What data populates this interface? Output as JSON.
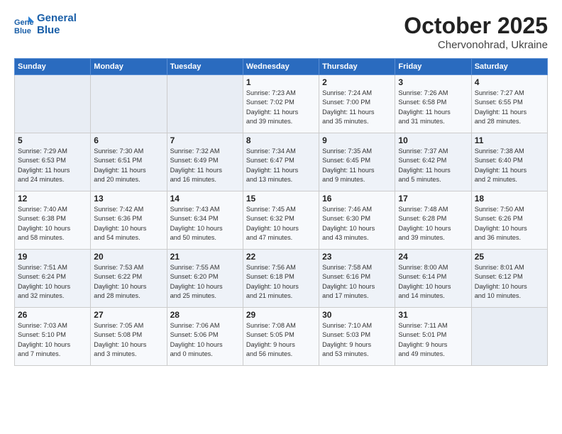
{
  "header": {
    "logo_line1": "General",
    "logo_line2": "Blue",
    "month": "October 2025",
    "location": "Chervonohrad, Ukraine"
  },
  "days_of_week": [
    "Sunday",
    "Monday",
    "Tuesday",
    "Wednesday",
    "Thursday",
    "Friday",
    "Saturday"
  ],
  "weeks": [
    [
      {
        "num": "",
        "info": ""
      },
      {
        "num": "",
        "info": ""
      },
      {
        "num": "",
        "info": ""
      },
      {
        "num": "1",
        "info": "Sunrise: 7:23 AM\nSunset: 7:02 PM\nDaylight: 11 hours\nand 39 minutes."
      },
      {
        "num": "2",
        "info": "Sunrise: 7:24 AM\nSunset: 7:00 PM\nDaylight: 11 hours\nand 35 minutes."
      },
      {
        "num": "3",
        "info": "Sunrise: 7:26 AM\nSunset: 6:58 PM\nDaylight: 11 hours\nand 31 minutes."
      },
      {
        "num": "4",
        "info": "Sunrise: 7:27 AM\nSunset: 6:55 PM\nDaylight: 11 hours\nand 28 minutes."
      }
    ],
    [
      {
        "num": "5",
        "info": "Sunrise: 7:29 AM\nSunset: 6:53 PM\nDaylight: 11 hours\nand 24 minutes."
      },
      {
        "num": "6",
        "info": "Sunrise: 7:30 AM\nSunset: 6:51 PM\nDaylight: 11 hours\nand 20 minutes."
      },
      {
        "num": "7",
        "info": "Sunrise: 7:32 AM\nSunset: 6:49 PM\nDaylight: 11 hours\nand 16 minutes."
      },
      {
        "num": "8",
        "info": "Sunrise: 7:34 AM\nSunset: 6:47 PM\nDaylight: 11 hours\nand 13 minutes."
      },
      {
        "num": "9",
        "info": "Sunrise: 7:35 AM\nSunset: 6:45 PM\nDaylight: 11 hours\nand 9 minutes."
      },
      {
        "num": "10",
        "info": "Sunrise: 7:37 AM\nSunset: 6:42 PM\nDaylight: 11 hours\nand 5 minutes."
      },
      {
        "num": "11",
        "info": "Sunrise: 7:38 AM\nSunset: 6:40 PM\nDaylight: 11 hours\nand 2 minutes."
      }
    ],
    [
      {
        "num": "12",
        "info": "Sunrise: 7:40 AM\nSunset: 6:38 PM\nDaylight: 10 hours\nand 58 minutes."
      },
      {
        "num": "13",
        "info": "Sunrise: 7:42 AM\nSunset: 6:36 PM\nDaylight: 10 hours\nand 54 minutes."
      },
      {
        "num": "14",
        "info": "Sunrise: 7:43 AM\nSunset: 6:34 PM\nDaylight: 10 hours\nand 50 minutes."
      },
      {
        "num": "15",
        "info": "Sunrise: 7:45 AM\nSunset: 6:32 PM\nDaylight: 10 hours\nand 47 minutes."
      },
      {
        "num": "16",
        "info": "Sunrise: 7:46 AM\nSunset: 6:30 PM\nDaylight: 10 hours\nand 43 minutes."
      },
      {
        "num": "17",
        "info": "Sunrise: 7:48 AM\nSunset: 6:28 PM\nDaylight: 10 hours\nand 39 minutes."
      },
      {
        "num": "18",
        "info": "Sunrise: 7:50 AM\nSunset: 6:26 PM\nDaylight: 10 hours\nand 36 minutes."
      }
    ],
    [
      {
        "num": "19",
        "info": "Sunrise: 7:51 AM\nSunset: 6:24 PM\nDaylight: 10 hours\nand 32 minutes."
      },
      {
        "num": "20",
        "info": "Sunrise: 7:53 AM\nSunset: 6:22 PM\nDaylight: 10 hours\nand 28 minutes."
      },
      {
        "num": "21",
        "info": "Sunrise: 7:55 AM\nSunset: 6:20 PM\nDaylight: 10 hours\nand 25 minutes."
      },
      {
        "num": "22",
        "info": "Sunrise: 7:56 AM\nSunset: 6:18 PM\nDaylight: 10 hours\nand 21 minutes."
      },
      {
        "num": "23",
        "info": "Sunrise: 7:58 AM\nSunset: 6:16 PM\nDaylight: 10 hours\nand 17 minutes."
      },
      {
        "num": "24",
        "info": "Sunrise: 8:00 AM\nSunset: 6:14 PM\nDaylight: 10 hours\nand 14 minutes."
      },
      {
        "num": "25",
        "info": "Sunrise: 8:01 AM\nSunset: 6:12 PM\nDaylight: 10 hours\nand 10 minutes."
      }
    ],
    [
      {
        "num": "26",
        "info": "Sunrise: 7:03 AM\nSunset: 5:10 PM\nDaylight: 10 hours\nand 7 minutes."
      },
      {
        "num": "27",
        "info": "Sunrise: 7:05 AM\nSunset: 5:08 PM\nDaylight: 10 hours\nand 3 minutes."
      },
      {
        "num": "28",
        "info": "Sunrise: 7:06 AM\nSunset: 5:06 PM\nDaylight: 10 hours\nand 0 minutes."
      },
      {
        "num": "29",
        "info": "Sunrise: 7:08 AM\nSunset: 5:05 PM\nDaylight: 9 hours\nand 56 minutes."
      },
      {
        "num": "30",
        "info": "Sunrise: 7:10 AM\nSunset: 5:03 PM\nDaylight: 9 hours\nand 53 minutes."
      },
      {
        "num": "31",
        "info": "Sunrise: 7:11 AM\nSunset: 5:01 PM\nDaylight: 9 hours\nand 49 minutes."
      },
      {
        "num": "",
        "info": ""
      }
    ]
  ]
}
